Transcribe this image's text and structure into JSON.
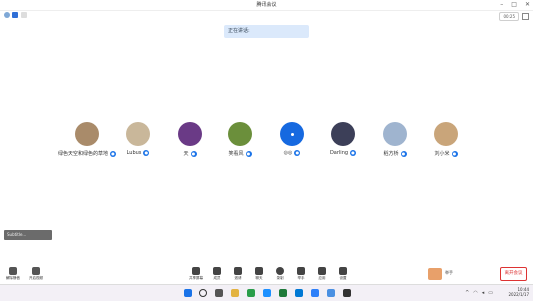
{
  "window": {
    "title": "腾讯会议"
  },
  "toolbar": {
    "timer": "00:25"
  },
  "speaking": {
    "text": "正在讲话:"
  },
  "participants": [
    {
      "name": "绿色天空和绿色的草地",
      "color": "#a98b6a"
    },
    {
      "name": "Lubus",
      "color": "#c9b79a"
    },
    {
      "name": "天",
      "color": "#6a3a86"
    },
    {
      "name": "笑看风",
      "color": "#6b8f3b"
    },
    {
      "name": "◎◎",
      "color": "#1669e0"
    },
    {
      "name": "Darling",
      "color": "#3c3f58"
    },
    {
      "name": "稻方桥",
      "color": "#9fb4cf"
    },
    {
      "name": "刘小米",
      "color": "#c9a57a"
    }
  ],
  "subtitle": {
    "label": "Subtitle..."
  },
  "controls": {
    "mic": "解除静音",
    "video": "开启视频",
    "items": [
      {
        "label": "共享屏幕",
        "icon": "share-screen-icon"
      },
      {
        "label": "成员",
        "icon": "members-icon"
      },
      {
        "label": "邀请",
        "icon": "invite-icon"
      },
      {
        "label": "聊天",
        "icon": "chat-icon"
      },
      {
        "label": "录制",
        "icon": "record-icon"
      },
      {
        "label": "举手",
        "icon": "hand-icon"
      },
      {
        "label": "应用",
        "icon": "apps-icon"
      },
      {
        "label": "设置",
        "icon": "settings-icon"
      }
    ],
    "raise_hand_label": "举手",
    "end_label": "离开会议"
  },
  "taskbar": {
    "time": "10:44",
    "date": "2022/1/17"
  }
}
